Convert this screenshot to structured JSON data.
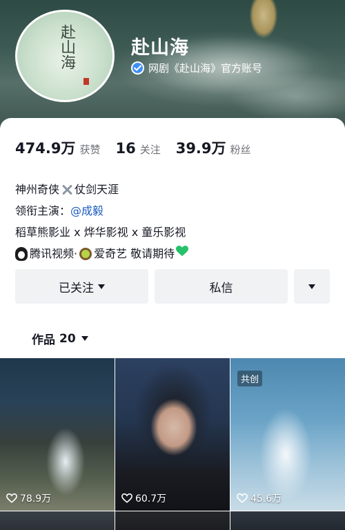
{
  "profile": {
    "name": "赴山海",
    "avatar_text": "赴山海",
    "verify_text": "网剧《赴山海》官方账号"
  },
  "stats": {
    "likes_value": "474.9万",
    "likes_label": "获赞",
    "following_value": "16",
    "following_label": "关注",
    "followers_value": "39.9万",
    "followers_label": "粉丝"
  },
  "bio": {
    "line1_a": "神州奇侠",
    "line1_b": "仗剑天涯",
    "line2_prefix": "领衔主演：",
    "line2_mention": "@成毅",
    "line3": "稻草熊影业 x 烨华影视 x 童乐影视",
    "line4_a": "腾讯视频·",
    "line4_b": "爱奇艺 敬请期待"
  },
  "actions": {
    "follow_label": "已关注",
    "message_label": "私信"
  },
  "works": {
    "tab_label": "作品",
    "count": "20",
    "videos": [
      {
        "likes": "78.9万",
        "tag": ""
      },
      {
        "likes": "60.7万",
        "tag": ""
      },
      {
        "likes": "45.6万",
        "tag": "共创"
      }
    ]
  },
  "icons": {
    "verified": "verified-check-icon",
    "dropdown": "caret-down-icon",
    "like": "heart-outline-icon"
  },
  "colors": {
    "verified_blue": "#3f8ef7",
    "mention_blue": "#1c5bbf",
    "button_bg": "#f1f2f4",
    "heart_green": "#25c26a"
  }
}
